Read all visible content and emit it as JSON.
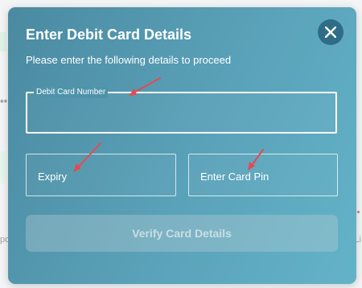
{
  "background": {
    "left_fragment_1": "**",
    "left_fragment_2": "po",
    "right_fragment_1": "Li"
  },
  "modal": {
    "title": "Enter Debit Card Details",
    "subtitle": "Please enter the following details to proceed",
    "close_icon": "close-icon",
    "card_number": {
      "label": "Debit Card Number",
      "value": ""
    },
    "expiry": {
      "placeholder": "Expiry",
      "value": ""
    },
    "card_pin": {
      "placeholder": "Enter Card Pin",
      "value": ""
    },
    "verify_button_label": "Verify Card Details"
  },
  "colors": {
    "modal_gradient_start": "#4a8aa1",
    "modal_gradient_end": "#63b3c8",
    "close_button_bg": "#2f6d86",
    "annotation_arrow": "#e8484f",
    "text": "#ffffff"
  }
}
